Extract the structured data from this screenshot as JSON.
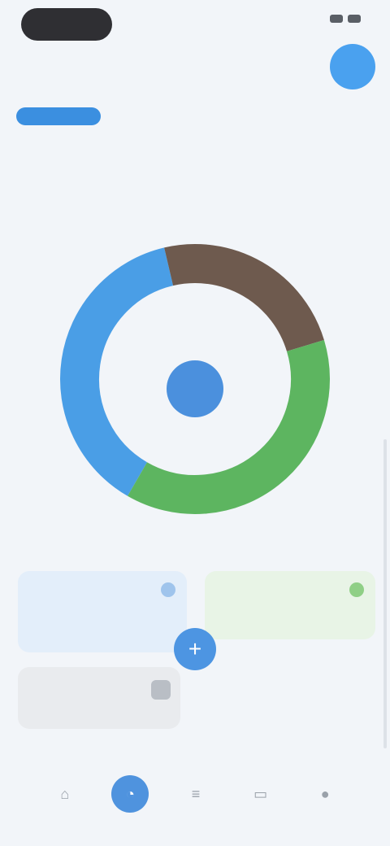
{
  "status_bar": {
    "time": "",
    "signal": "",
    "battery": ""
  },
  "header": {
    "title": "",
    "avatar_initial": ""
  },
  "filters": {
    "items": [
      {
        "label": "",
        "active": true
      },
      {
        "label": "",
        "active": false
      },
      {
        "label": "",
        "active": false
      },
      {
        "label": "",
        "active": false
      }
    ]
  },
  "section": {
    "title": "",
    "link": ""
  },
  "chart_data": {
    "type": "pie",
    "style": "donut",
    "series": [
      {
        "values": [
          38,
          24,
          38
        ]
      }
    ],
    "colors": [
      "#4a9ee6",
      "#6e5a4e",
      "#5db560"
    ],
    "center_label": ""
  },
  "cards": {
    "blue": {
      "label": "",
      "value": ""
    },
    "green": {
      "label": "",
      "value": ""
    },
    "gray": {
      "label": "",
      "value": ""
    }
  },
  "fab": {
    "icon": "plus-icon",
    "glyph": "+"
  },
  "bottom_nav": {
    "items": [
      {
        "icon": "home-icon",
        "glyph": "⌂",
        "active": false
      },
      {
        "icon": "chart-icon",
        "glyph": "◔",
        "active": true
      },
      {
        "icon": "list-icon",
        "glyph": "≡",
        "active": false
      },
      {
        "icon": "wallet-icon",
        "glyph": "▭",
        "active": false
      },
      {
        "icon": "profile-icon",
        "glyph": "●",
        "active": false
      }
    ]
  }
}
